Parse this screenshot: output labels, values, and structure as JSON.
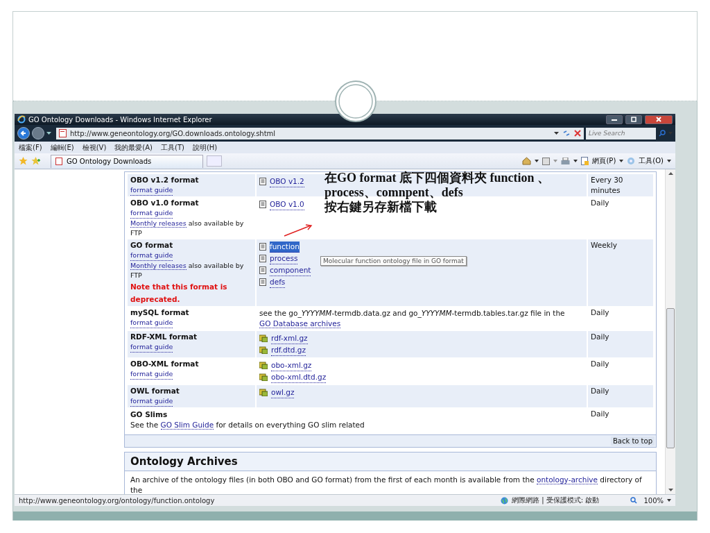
{
  "browser": {
    "title": "GO Ontology Downloads - Windows Internet Explorer",
    "address": "http://www.geneontology.org/GO.downloads.ontology.shtml",
    "search_placeholder": "Live Search",
    "menu": [
      "檔案(F)",
      "編輯(E)",
      "檢視(V)",
      "我的最愛(A)",
      "工具(T)",
      "說明(H)"
    ],
    "tab": "GO Ontology Downloads",
    "command_menus": [
      "網頁(P)",
      "工具(O)"
    ]
  },
  "downloads_table": {
    "rows": [
      {
        "kind": "files",
        "name": "OBO v1.2 format",
        "guide": "format guide",
        "files": [
          {
            "label": "OBO v1.2",
            "kind": "text",
            "selected": false
          }
        ],
        "frequency": "Every 30 minutes"
      },
      {
        "kind": "files",
        "name": "OBO v1.0 format",
        "guide": "format guide",
        "extra_link": "Monthly releases",
        "extra_text": "also available by FTP",
        "files": [
          {
            "label": "OBO v1.0",
            "kind": "text",
            "selected": false
          }
        ],
        "frequency": "Daily"
      },
      {
        "kind": "files",
        "name": "GO format",
        "guide": "format guide",
        "extra_link": "Monthly releases",
        "extra_text": "also available by FTP",
        "warning": "Note that this format is deprecated.",
        "files": [
          {
            "label": "function",
            "kind": "text",
            "selected": true
          },
          {
            "label": "process",
            "kind": "text",
            "selected": false
          },
          {
            "label": "component",
            "kind": "text",
            "selected": false
          },
          {
            "label": "defs",
            "kind": "text",
            "selected": false
          }
        ],
        "frequency": "Weekly"
      },
      {
        "kind": "description",
        "name": "mySQL format",
        "guide": "format guide",
        "description": {
          "segments": [
            {
              "text": "see the go_",
              "italic": false
            },
            {
              "text": "YYYYMM",
              "italic": true
            },
            {
              "text": "-termdb.data.gz and go_",
              "italic": false
            },
            {
              "text": "YYYYMM",
              "italic": true
            },
            {
              "text": "-termdb.tables.tar.gz file in the",
              "italic": false
            }
          ],
          "link": "GO Database archives"
        },
        "frequency": "Daily"
      },
      {
        "kind": "files",
        "name": "RDF-XML format",
        "guide": "format guide",
        "files": [
          {
            "label": "rdf-xml.gz",
            "kind": "archive",
            "selected": false
          },
          {
            "label": "rdf.dtd.gz",
            "kind": "archive",
            "selected": false
          }
        ],
        "frequency": "Daily"
      },
      {
        "kind": "files",
        "name": "OBO-XML format",
        "guide": "format guide",
        "files": [
          {
            "label": "obo-xml.gz",
            "kind": "archive",
            "selected": false
          },
          {
            "label": "obo-xml.dtd.gz",
            "kind": "archive",
            "selected": false
          }
        ],
        "frequency": "Daily"
      },
      {
        "kind": "files",
        "name": "OWL format",
        "guide": "format guide",
        "files": [
          {
            "label": "owl.gz",
            "kind": "archive",
            "selected": false
          }
        ],
        "frequency": "Daily"
      },
      {
        "kind": "wide",
        "name": "GO Slims",
        "description": {
          "before": "See the",
          "link": "GO Slim Guide",
          "after": "for details on everything GO slim related"
        },
        "frequency": "Daily"
      }
    ]
  },
  "tooltip": "Molecular function ontology file in GO format",
  "back_to_top": "Back to top",
  "archives": {
    "heading": "Ontology Archives",
    "before": "An archive of the ontology files (in both OBO and GO format) from the first of each month is available from the",
    "link": "ontology-archive",
    "after": "directory of the"
  },
  "status_bar": {
    "url": "http://www.geneontology.org/ontology/function.ontology",
    "zone": "網際網路 | 受保護模式: 啟動",
    "zoom": "100%"
  },
  "annotation": {
    "lines": [
      "在GO format 底下四個資料夾 function 、",
      "process、comnpent、defs",
      "按右鍵另存新檔下載"
    ]
  }
}
